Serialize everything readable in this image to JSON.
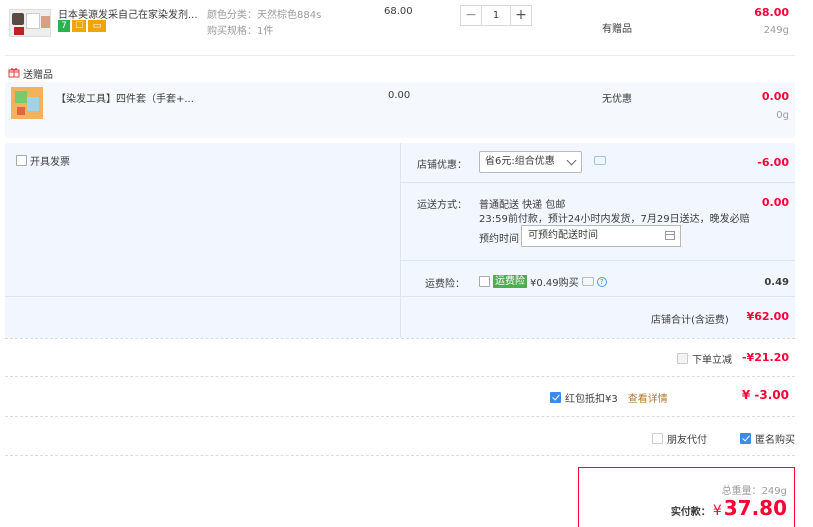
{
  "item": {
    "title": "日本美源发采自己在家染发剂...",
    "color_label": "颜色分类：",
    "color_value": "天然棕色884s",
    "spec_label": "购买规格：",
    "spec_value": "1件",
    "unit_price": "68.00",
    "quantity": "1",
    "qty_minus": "−",
    "qty_plus": "+",
    "gift_status": "有赠品",
    "total": "68.00",
    "weight": "249g",
    "badges": [
      "7",
      "☐",
      "▭"
    ]
  },
  "gift": {
    "section_label": "送赠品",
    "title": "【染发工具】四件套（手套+...",
    "unit_price": "0.00",
    "promo": "无优惠",
    "total": "0.00",
    "weight": "0g"
  },
  "invoice": {
    "label": "开具发票"
  },
  "shop_discount": {
    "label": "店铺优惠：",
    "selected": "省6元:组合优惠",
    "amount": "-6.00"
  },
  "shipping": {
    "label": "运送方式：",
    "method": "普通配送 快递 包邮",
    "note": "23:59前付款，预计24小时内发货，7月29日送达，晚发必赔",
    "reserve_label": "预约时间",
    "reserve_placeholder": "可预约配送时间",
    "amount": "0.00"
  },
  "insurance": {
    "label": "运费险：",
    "tag": "运费险",
    "price": "¥0.49购买",
    "amount": "0.49"
  },
  "shop_total": {
    "label": "店铺合计(含运费)",
    "amount": "¥62.00"
  },
  "instant_discount": {
    "label": "下单立减",
    "amount": "-¥21.20"
  },
  "red_packet": {
    "label": "红包抵扣¥3",
    "link": "查看详情",
    "amount": "¥ -3.00"
  },
  "options": {
    "friend_pay": "朋友代付",
    "anonymous": "匿名购买"
  },
  "summary": {
    "weight_label": "总重量：",
    "weight_value": "249g",
    "pay_label": "实付款：",
    "currency": "¥",
    "pay_amount": "37.80"
  },
  "colors": {
    "accent": "#ff0036",
    "blue": "#3c8bea",
    "panel": "#f2f7ff"
  }
}
